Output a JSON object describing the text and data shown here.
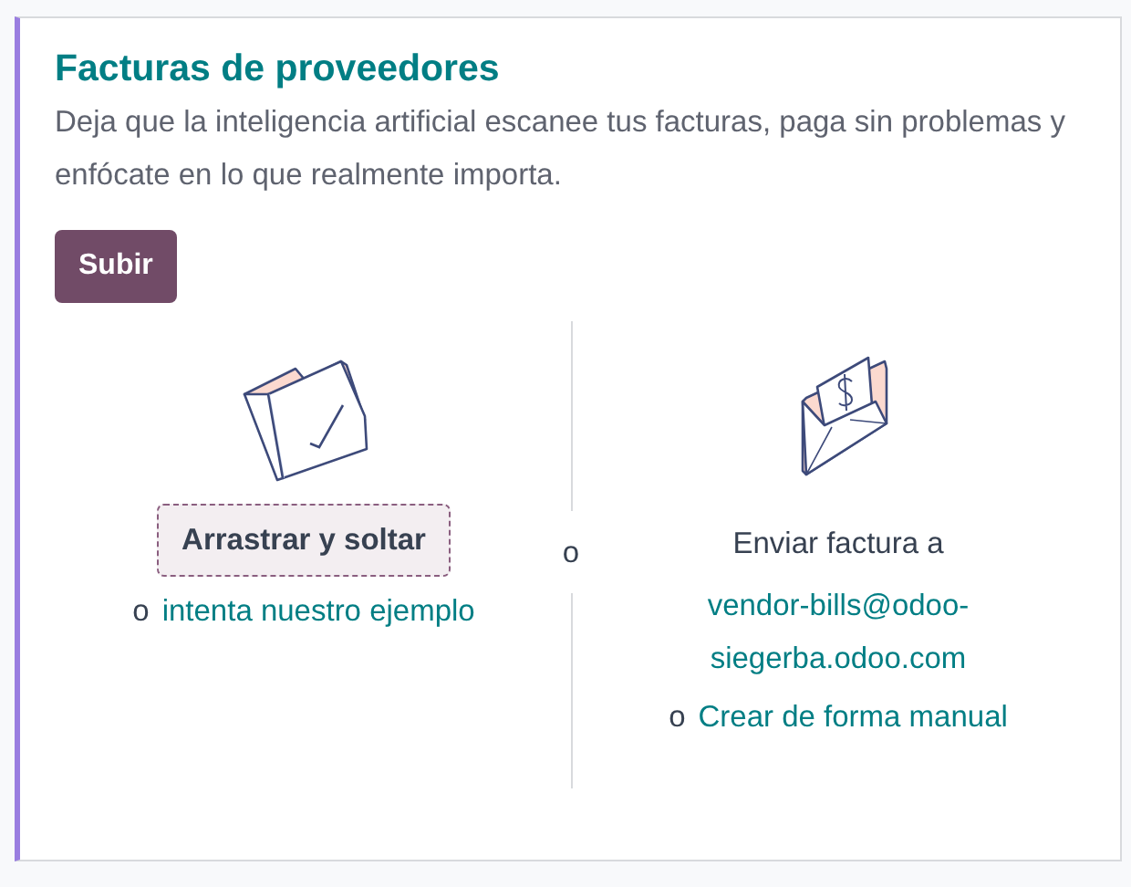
{
  "card": {
    "title": "Facturas de proveedores",
    "description": "Deja que la inteligencia artificial escanee tus facturas, paga sin problemas y enfócate en lo que realmente importa.",
    "upload_button": "Subir",
    "left": {
      "drop_button": "Arrastrar y soltar",
      "or": "o",
      "link": "intenta nuestro ejemplo"
    },
    "separator": "o",
    "right": {
      "label": "Enviar factura a",
      "email": "vendor-bills@odoo-siegerba.odoo.com",
      "or": "o",
      "link": "Crear de forma manual"
    }
  }
}
